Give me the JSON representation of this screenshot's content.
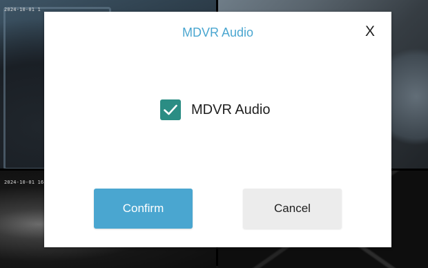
{
  "background": {
    "camera_stamps": [
      "2024-10-01 1",
      "2024-10-01 16"
    ]
  },
  "dialog": {
    "title": "MDVR Audio",
    "close_label": "X",
    "checkbox": {
      "label": "MDVR Audio",
      "checked": true
    },
    "confirm_label": "Confirm",
    "cancel_label": "Cancel"
  },
  "colors": {
    "accent": "#4aa6d0",
    "checkbox": "#2b8d84",
    "cancel_bg": "#ececec"
  },
  "icons": {
    "checkmark": "check-icon"
  }
}
